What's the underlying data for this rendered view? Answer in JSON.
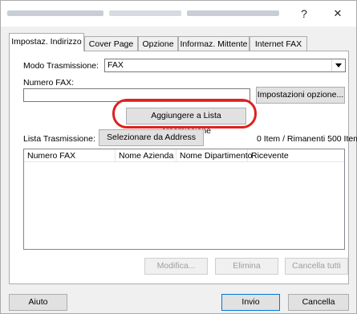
{
  "titlebar": {
    "help_glyph": "?",
    "close_glyph": "✕"
  },
  "tabs": [
    {
      "label": "Impostaz. Indirizzo",
      "active": true
    },
    {
      "label": "Cover Page",
      "active": false
    },
    {
      "label": "Opzione",
      "active": false
    },
    {
      "label": "Informaz. Mittente",
      "active": false
    },
    {
      "label": "Internet FAX",
      "active": false
    }
  ],
  "form": {
    "mode_label": "Modo Trasmissione:",
    "mode_value": "FAX",
    "fax_number_label": "Numero FAX:",
    "fax_number_value": "",
    "options_button": "Impostazioni opzione...",
    "add_button": "Aggiungere a Lista Trasmissione",
    "list_label": "Lista Trasmissione:",
    "address_book_button": "Selezionare da Address Book...",
    "count_text": "0 Item / Rimanenti 500 Item"
  },
  "table": {
    "columns": [
      "Numero FAX",
      "Nome Azienda",
      "Nome Dipartimento",
      "Ricevente"
    ],
    "rows": []
  },
  "list_actions": {
    "edit": "Modifica...",
    "delete": "Elimina",
    "clear_all": "Cancella tutti"
  },
  "footer": {
    "help": "Aiuto",
    "send": "Invio",
    "cancel": "Cancella"
  },
  "colors": {
    "highlight": "#e02020",
    "window_bg": "#f0f0f0"
  }
}
